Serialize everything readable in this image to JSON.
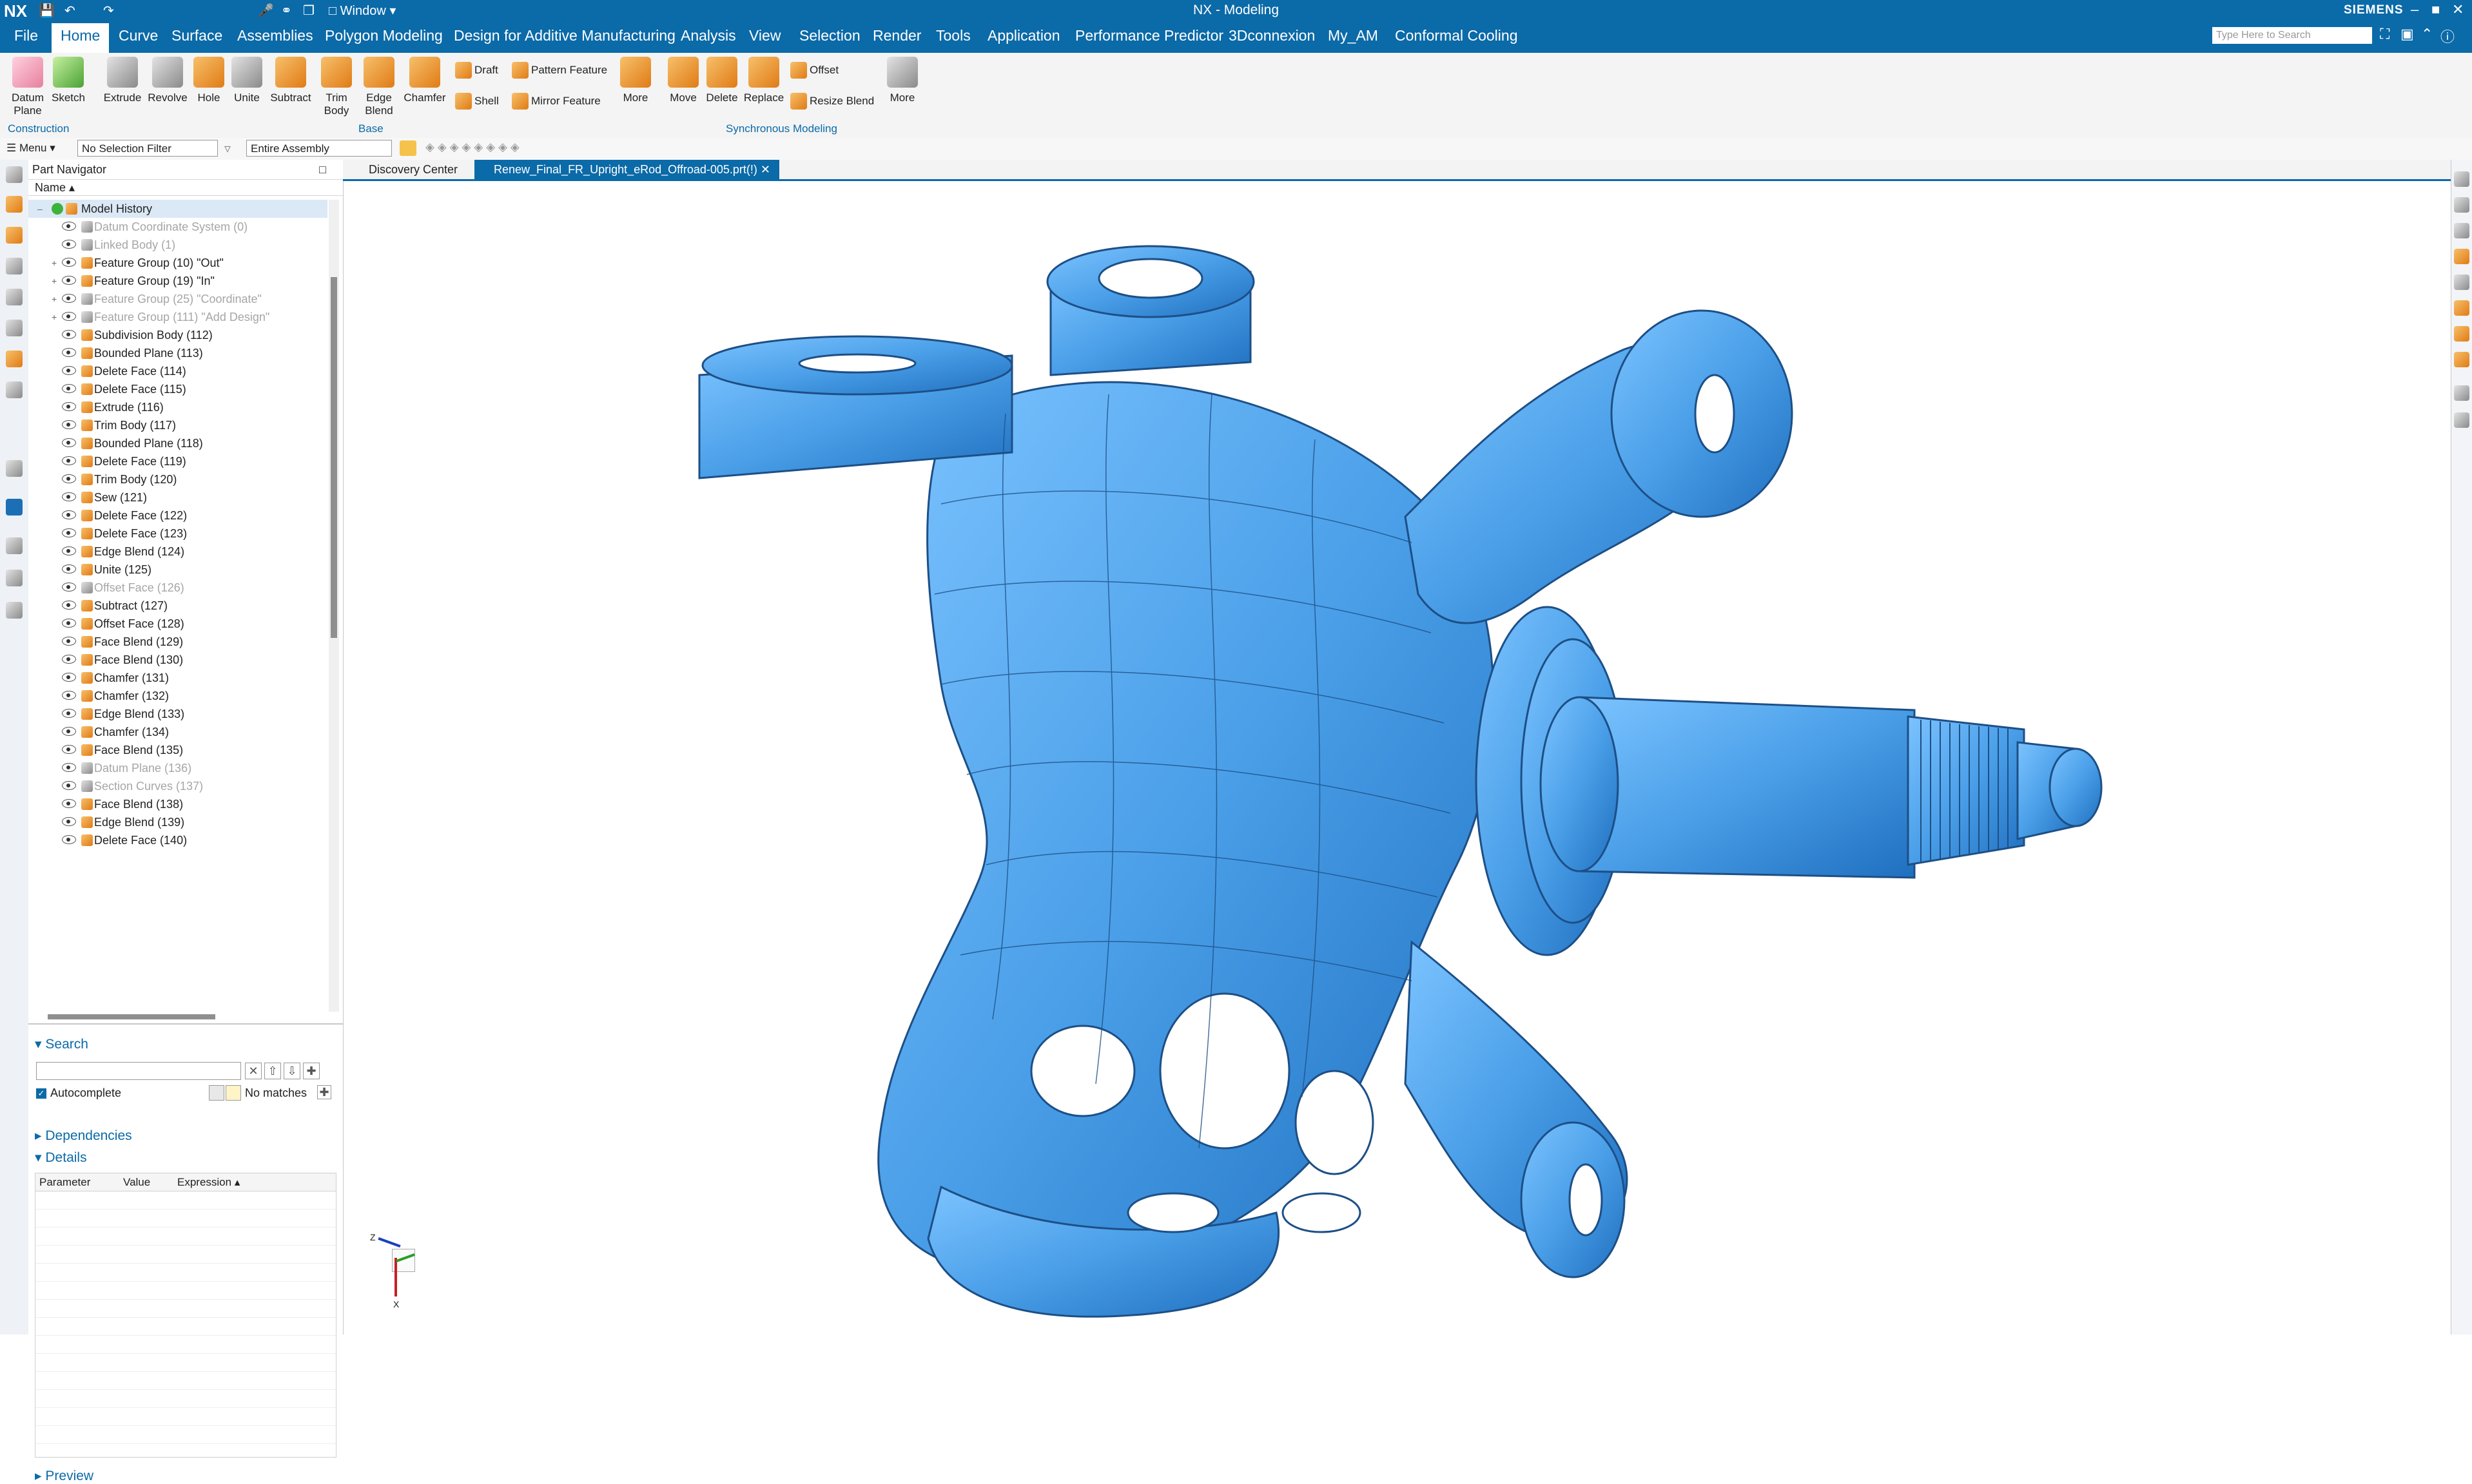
{
  "titlebar": {
    "logo": "NX",
    "window_menu": "Window",
    "title": "NX - Modeling",
    "brand": "SIEMENS"
  },
  "menu": {
    "tabs": [
      "File",
      "Home",
      "Curve",
      "Surface",
      "Assemblies",
      "Polygon Modeling",
      "Design for Additive Manufacturing",
      "Analysis",
      "View",
      "Selection",
      "Render",
      "Tools",
      "Application",
      "Performance Predictor",
      "3Dconnexion",
      "My_AM",
      "Conformal Cooling"
    ],
    "active_tab": "Home",
    "search_placeholder": "Type Here to Search"
  },
  "ribbon": {
    "construction": {
      "items": [
        "Datum Plane",
        "Sketch"
      ],
      "group_label": "Construction"
    },
    "base": {
      "items": [
        "Extrude",
        "Revolve",
        "Hole",
        "Unite",
        "Subtract",
        "Trim Body",
        "Edge Blend",
        "Chamfer"
      ],
      "small": [
        "Draft",
        "Shell",
        "Pattern Feature",
        "Mirror Feature"
      ],
      "more": "More",
      "group_label": "Base"
    },
    "sync": {
      "items": [
        "Move",
        "Delete",
        "Replace"
      ],
      "small": [
        "Offset",
        "Resize Blend"
      ],
      "more": "More",
      "group_label": "Synchronous Modeling"
    }
  },
  "selection_bar": {
    "menu_label": "Menu",
    "filter": "No Selection Filter",
    "scope": "Entire Assembly"
  },
  "navigator": {
    "title": "Part Navigator",
    "column_name": "Name",
    "rows": [
      {
        "label": "Model History",
        "dim": false,
        "level": 0,
        "sel": true
      },
      {
        "label": "Datum Coordinate System (0)",
        "dim": true,
        "level": 1
      },
      {
        "label": "Linked Body (1)",
        "dim": true,
        "level": 1
      },
      {
        "label": "Feature Group (10) \"Out\"",
        "dim": false,
        "level": 1,
        "exp": true
      },
      {
        "label": "Feature Group (19) \"In\"",
        "dim": false,
        "level": 1,
        "exp": true
      },
      {
        "label": "Feature Group (25) \"Coordinate\"",
        "dim": true,
        "level": 1,
        "exp": true
      },
      {
        "label": "Feature Group (111) \"Add Design\"",
        "dim": true,
        "level": 1,
        "exp": true
      },
      {
        "label": "Subdivision Body (112)",
        "dim": false,
        "level": 1
      },
      {
        "label": "Bounded Plane (113)",
        "dim": false,
        "level": 1
      },
      {
        "label": "Delete Face (114)",
        "dim": false,
        "level": 1
      },
      {
        "label": "Delete Face (115)",
        "dim": false,
        "level": 1
      },
      {
        "label": "Extrude (116)",
        "dim": false,
        "level": 1
      },
      {
        "label": "Trim Body (117)",
        "dim": false,
        "level": 1
      },
      {
        "label": "Bounded Plane (118)",
        "dim": false,
        "level": 1
      },
      {
        "label": "Delete Face (119)",
        "dim": false,
        "level": 1
      },
      {
        "label": "Trim Body (120)",
        "dim": false,
        "level": 1
      },
      {
        "label": "Sew (121)",
        "dim": false,
        "level": 1
      },
      {
        "label": "Delete Face (122)",
        "dim": false,
        "level": 1
      },
      {
        "label": "Delete Face (123)",
        "dim": false,
        "level": 1
      },
      {
        "label": "Edge Blend (124)",
        "dim": false,
        "level": 1
      },
      {
        "label": "Unite (125)",
        "dim": false,
        "level": 1
      },
      {
        "label": "Offset Face (126)",
        "dim": true,
        "level": 1
      },
      {
        "label": "Subtract (127)",
        "dim": false,
        "level": 1
      },
      {
        "label": "Offset Face (128)",
        "dim": false,
        "level": 1
      },
      {
        "label": "Face Blend (129)",
        "dim": false,
        "level": 1
      },
      {
        "label": "Face Blend (130)",
        "dim": false,
        "level": 1
      },
      {
        "label": "Chamfer (131)",
        "dim": false,
        "level": 1
      },
      {
        "label": "Chamfer (132)",
        "dim": false,
        "level": 1
      },
      {
        "label": "Edge Blend (133)",
        "dim": false,
        "level": 1
      },
      {
        "label": "Chamfer (134)",
        "dim": false,
        "level": 1
      },
      {
        "label": "Face Blend (135)",
        "dim": false,
        "level": 1
      },
      {
        "label": "Datum Plane (136)",
        "dim": true,
        "level": 1
      },
      {
        "label": "Section Curves (137)",
        "dim": true,
        "level": 1
      },
      {
        "label": "Face Blend (138)",
        "dim": false,
        "level": 1
      },
      {
        "label": "Edge Blend (139)",
        "dim": false,
        "level": 1
      },
      {
        "label": "Delete Face (140)",
        "dim": false,
        "level": 1
      }
    ],
    "search": {
      "title": "Search",
      "autocomplete": "Autocomplete",
      "result": "No matches"
    },
    "dependencies": "Dependencies",
    "details": {
      "title": "Details",
      "columns": [
        "Parameter",
        "Value",
        "Expression"
      ]
    },
    "preview": "Preview"
  },
  "documents": {
    "tabs": [
      "Discovery Center",
      "Renew_Final_FR_Upright_eRod_Offroad-005.prt(!)"
    ],
    "active": 1
  },
  "viewport": {
    "model_color": "#4a9fe8",
    "triad": {
      "x": "X",
      "y": "Y",
      "z": "Z"
    }
  }
}
